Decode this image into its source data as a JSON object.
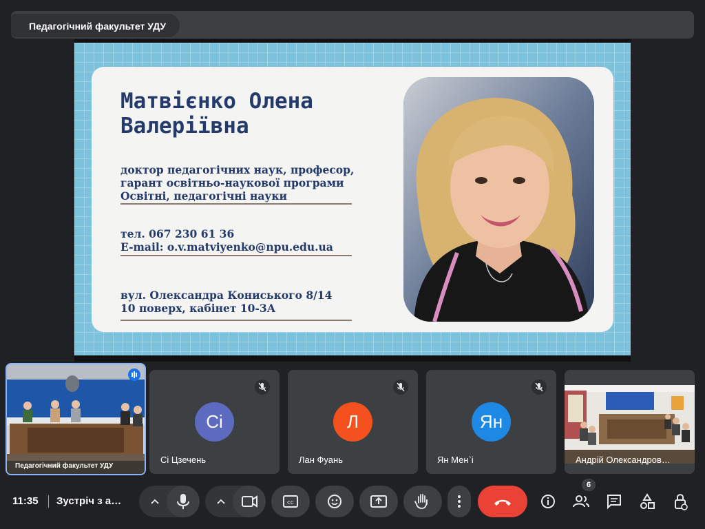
{
  "presenter": {
    "name": "Педагогічний факультет УДУ"
  },
  "slide": {
    "name_line1": "Матвієнко Олена",
    "name_line2": "Валеріївна",
    "info1_line1": "доктор педагогічних наук, професор,",
    "info1_line2": "гарант освітньо-наукової програми",
    "info1_line3": "Освітні, педагогічні науки",
    "phone": "тел. 067 230 61 36",
    "email": "E-mail: o.v.matviyenko@npu.edu.ua",
    "address_line1": "вул. Олександра Кониського 8/14",
    "address_line2": "10 поверх, кабінет 10-3А",
    "photo_icon": "person-portrait"
  },
  "tiles": {
    "self": {
      "name": "Педагогічний факультет УДУ",
      "icon": "speaking-indicator-icon"
    },
    "t1": {
      "initials": "Сі",
      "name": "Сі Цзечень",
      "color": "#5c6bc0",
      "icon": "mic-off-icon"
    },
    "t2": {
      "initials": "Л",
      "name": "Лан Фуань",
      "color": "#f4511e",
      "icon": "mic-off-icon"
    },
    "t3": {
      "initials": "Ян",
      "name": "Ян Мен`і",
      "color": "#1e88e5",
      "icon": "mic-off-icon"
    },
    "t4": {
      "name": "Андрій Олександров…"
    }
  },
  "bottom_bar": {
    "time": "11:35",
    "meeting_title": "Зустріч з а…",
    "participants_count": "6",
    "icons": [
      "chevron-up-icon",
      "mic-icon",
      "chevron-up-icon",
      "camera-icon",
      "captions-icon",
      "emoji-icon",
      "present-icon",
      "raise-hand-icon",
      "more-icon",
      "end-call-icon",
      "info-icon",
      "people-icon",
      "chat-icon",
      "activities-icon",
      "host-controls-icon"
    ]
  },
  "colors": {
    "end_call": "#ea4335",
    "selected_border": "#8ab4f8",
    "slide_bg": "#7cc2dc",
    "name_text": "#243a6b"
  }
}
